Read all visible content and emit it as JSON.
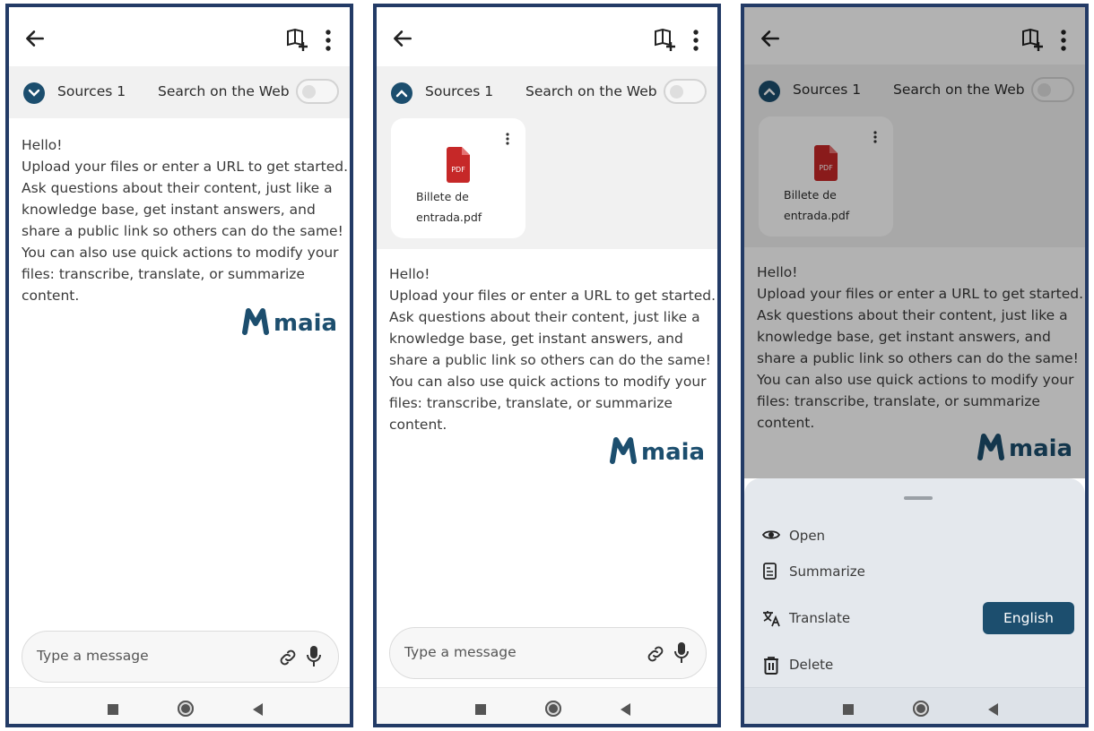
{
  "header": {
    "back_icon": "arrow-left-icon",
    "add_source_icon": "book-plus-icon",
    "menu_icon": "vertical-dots-icon"
  },
  "sources": {
    "label": "Sources",
    "count": "1",
    "web_search_label": "Search on the Web",
    "web_search_enabled": false
  },
  "file": {
    "name_line1": "Billete de",
    "name_line2": "entrada.pdf",
    "type_badge": "PDF"
  },
  "welcome": {
    "lines": [
      "Hello!",
      "Upload your files or enter a URL to get started.",
      "Ask questions about their content, just like a",
      "knowledge base, get instant answers, and",
      "share a public link so others can do the same!",
      "You can also use quick actions to modify your",
      "files: transcribe, translate, or summarize",
      "content."
    ]
  },
  "brand": {
    "logo_text": "maia",
    "color": "#1c4e6e"
  },
  "composer": {
    "placeholder": "Type a message",
    "attach_icon": "link-icon",
    "mic_icon": "microphone-icon"
  },
  "sheet": {
    "options": [
      {
        "label": "Open",
        "icon": "eye-icon"
      },
      {
        "label": "Summarize",
        "icon": "document-icon"
      },
      {
        "label": "Translate",
        "icon": "translate-icon"
      },
      {
        "label": "Delete",
        "icon": "trash-icon"
      }
    ],
    "language_button": "English"
  },
  "colors": {
    "accent": "#1c4e6e",
    "pdf": "#c62828",
    "frame": "#233b66"
  }
}
